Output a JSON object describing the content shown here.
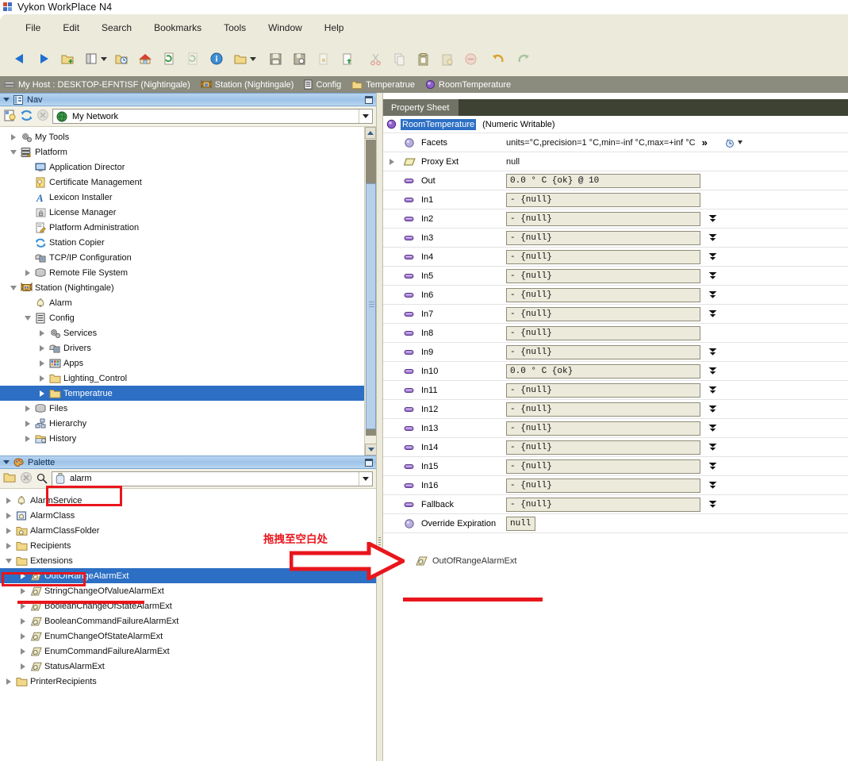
{
  "window": {
    "title": "Vykon WorkPlace N4",
    "icon": "app-logo-icon"
  },
  "menubar": {
    "items": [
      "File",
      "Edit",
      "Search",
      "Bookmarks",
      "Tools",
      "Window",
      "Help"
    ]
  },
  "toolbar": {
    "buttons": [
      {
        "name": "back-icon",
        "label": "Back"
      },
      {
        "name": "forward-icon",
        "label": "Forward"
      },
      {
        "name": "up-folder-icon",
        "label": "Up Level"
      },
      {
        "name": "side-bars-icon",
        "label": "Side Bars",
        "has_caret": true
      },
      {
        "name": "recent-folder-icon",
        "label": "Recent"
      },
      {
        "name": "home-icon",
        "label": "Home"
      },
      {
        "name": "refresh-page-icon",
        "label": "Refresh"
      },
      {
        "name": "refresh-page-disabled-icon",
        "label": "Refresh All"
      },
      {
        "name": "info-icon",
        "label": "Info"
      },
      {
        "name": "open-folder-icon",
        "label": "Open",
        "has_caret": true
      },
      {
        "name": "save-icon",
        "label": "Save"
      },
      {
        "name": "save-as-icon",
        "label": "Save As"
      },
      {
        "name": "lock-page-icon",
        "label": "Lock"
      },
      {
        "name": "new-page-icon",
        "label": "New"
      },
      {
        "name": "cut-icon",
        "label": "Cut"
      },
      {
        "name": "copy-icon",
        "label": "Copy"
      },
      {
        "name": "paste-icon",
        "label": "Paste"
      },
      {
        "name": "paste-special-icon",
        "label": "Paste Special"
      },
      {
        "name": "delete-icon",
        "label": "Delete"
      },
      {
        "name": "undo-icon",
        "label": "Undo"
      },
      {
        "name": "redo-icon",
        "label": "Redo"
      }
    ]
  },
  "locator": {
    "crumbs": [
      {
        "icon": "host-icon",
        "label": "My Host : DESKTOP-EFNTISF (Nightingale)"
      },
      {
        "icon": "station-icon",
        "label": "Station (Nightingale)"
      },
      {
        "icon": "config-icon",
        "label": "Config"
      },
      {
        "icon": "folder-icon",
        "label": "Temperatrue"
      },
      {
        "icon": "point-icon",
        "label": "RoomTemperature"
      }
    ]
  },
  "nav": {
    "panel_title": "Nav",
    "ord_value": "My Network",
    "toolbar_icons": [
      "new-bookmark-icon",
      "sync-icon",
      "stop-icon"
    ],
    "tree": [
      {
        "label": "My Tools",
        "indent": 1,
        "twisty": "closed",
        "icon": "gears-icon"
      },
      {
        "label": "Platform",
        "indent": 1,
        "twisty": "open",
        "icon": "platform-icon"
      },
      {
        "label": "Application Director",
        "indent": 2,
        "twisty": "none",
        "icon": "monitor-icon"
      },
      {
        "label": "Certificate Management",
        "indent": 2,
        "twisty": "none",
        "icon": "certificate-icon"
      },
      {
        "label": "Lexicon Installer",
        "indent": 2,
        "twisty": "none",
        "icon": "lexicon-a-icon"
      },
      {
        "label": "License Manager",
        "indent": 2,
        "twisty": "none",
        "icon": "license-lock-icon"
      },
      {
        "label": "Platform Administration",
        "indent": 2,
        "twisty": "none",
        "icon": "admin-pencil-icon"
      },
      {
        "label": "Station Copier",
        "indent": 2,
        "twisty": "none",
        "icon": "sync-icon"
      },
      {
        "label": "TCP/IP Configuration",
        "indent": 2,
        "twisty": "none",
        "icon": "network-icon"
      },
      {
        "label": "Remote File System",
        "indent": 2,
        "twisty": "closed",
        "icon": "drive-icon"
      },
      {
        "label": "Station (Nightingale)",
        "indent": 1,
        "twisty": "open",
        "icon": "station-icon"
      },
      {
        "label": "Alarm",
        "indent": 2,
        "twisty": "none",
        "icon": "bell-icon"
      },
      {
        "label": "Config",
        "indent": 2,
        "twisty": "open",
        "icon": "config-icon"
      },
      {
        "label": "Services",
        "indent": 3,
        "twisty": "closed",
        "icon": "gears-icon"
      },
      {
        "label": "Drivers",
        "indent": 3,
        "twisty": "closed",
        "icon": "network-icon"
      },
      {
        "label": "Apps",
        "indent": 3,
        "twisty": "closed",
        "icon": "apps-icon"
      },
      {
        "label": "Lighting_Control",
        "indent": 3,
        "twisty": "closed",
        "icon": "folder-icon"
      },
      {
        "label": "Temperatrue",
        "indent": 3,
        "twisty": "closed",
        "icon": "folder-icon",
        "selected": true
      },
      {
        "label": "Files",
        "indent": 2,
        "twisty": "closed",
        "icon": "drive-icon"
      },
      {
        "label": "Hierarchy",
        "indent": 2,
        "twisty": "closed",
        "icon": "hierarchy-icon"
      },
      {
        "label": "History",
        "indent": 2,
        "twisty": "closed",
        "icon": "history-icon"
      }
    ]
  },
  "palette": {
    "panel_title": "Palette",
    "toolbar_icons": [
      "open-palette-icon",
      "close-palette-icon",
      "search-icon"
    ],
    "module_value": "alarm",
    "tree": [
      {
        "label": "AlarmService",
        "indent": 1,
        "twisty": "closed",
        "icon": "bell-icon"
      },
      {
        "label": "AlarmClass",
        "indent": 1,
        "twisty": "closed",
        "icon": "alarm-class-icon"
      },
      {
        "label": "AlarmClassFolder",
        "indent": 1,
        "twisty": "closed",
        "icon": "alarm-folder-icon"
      },
      {
        "label": "Recipients",
        "indent": 1,
        "twisty": "closed",
        "icon": "folder-icon"
      },
      {
        "label": "Extensions",
        "indent": 1,
        "twisty": "open",
        "icon": "folder-icon",
        "boxed": true
      },
      {
        "label": "OutOfRangeAlarmExt",
        "indent": 2,
        "twisty": "closed",
        "icon": "alarm-ext-icon",
        "selected": true,
        "underlined": true
      },
      {
        "label": "StringChangeOfValueAlarmExt",
        "indent": 2,
        "twisty": "closed",
        "icon": "alarm-ext-icon"
      },
      {
        "label": "BooleanChangeOfStateAlarmExt",
        "indent": 2,
        "twisty": "closed",
        "icon": "alarm-ext-icon"
      },
      {
        "label": "BooleanCommandFailureAlarmExt",
        "indent": 2,
        "twisty": "closed",
        "icon": "alarm-ext-icon"
      },
      {
        "label": "EnumChangeOfStateAlarmExt",
        "indent": 2,
        "twisty": "closed",
        "icon": "alarm-ext-icon"
      },
      {
        "label": "EnumCommandFailureAlarmExt",
        "indent": 2,
        "twisty": "closed",
        "icon": "alarm-ext-icon"
      },
      {
        "label": "StatusAlarmExt",
        "indent": 2,
        "twisty": "closed",
        "icon": "alarm-ext-icon"
      },
      {
        "label": "PrinterRecipients",
        "indent": 1,
        "twisty": "closed",
        "icon": "folder-icon"
      }
    ]
  },
  "property_sheet": {
    "tab_label": "Property Sheet",
    "object_name": "RoomTemperature",
    "object_type": "(Numeric Writable)",
    "facets_more": "≫",
    "rows": [
      {
        "name": "Facets",
        "icon": "point-icon",
        "kind": "text",
        "value": "units=°C,precision=1 °C,min=-inf °C,max=+inf °C",
        "extra": "facets-edit-icon"
      },
      {
        "name": "Proxy Ext",
        "icon": "proxy-icon",
        "kind": "text",
        "value": "null",
        "twisty": "closed"
      },
      {
        "name": "Out",
        "icon": "slot-icon",
        "kind": "box",
        "value": "0.0 ° C {ok} @ 10",
        "dropdown": false
      },
      {
        "name": "In1",
        "icon": "slot-icon",
        "kind": "box",
        "value": "- {null}",
        "dropdown": false
      },
      {
        "name": "In2",
        "icon": "slot-icon",
        "kind": "box",
        "value": "- {null}",
        "dropdown": true
      },
      {
        "name": "In3",
        "icon": "slot-icon",
        "kind": "box",
        "value": "- {null}",
        "dropdown": true
      },
      {
        "name": "In4",
        "icon": "slot-icon",
        "kind": "box",
        "value": "- {null}",
        "dropdown": true
      },
      {
        "name": "In5",
        "icon": "slot-icon",
        "kind": "box",
        "value": "- {null}",
        "dropdown": true
      },
      {
        "name": "In6",
        "icon": "slot-icon",
        "kind": "box",
        "value": "- {null}",
        "dropdown": true
      },
      {
        "name": "In7",
        "icon": "slot-icon",
        "kind": "box",
        "value": "- {null}",
        "dropdown": true
      },
      {
        "name": "In8",
        "icon": "slot-icon",
        "kind": "box",
        "value": "- {null}",
        "dropdown": false
      },
      {
        "name": "In9",
        "icon": "slot-icon",
        "kind": "box",
        "value": "- {null}",
        "dropdown": true
      },
      {
        "name": "In10",
        "icon": "slot-icon",
        "kind": "box",
        "value": "0.0 ° C {ok}",
        "dropdown": true
      },
      {
        "name": "In11",
        "icon": "slot-icon",
        "kind": "box",
        "value": "- {null}",
        "dropdown": true
      },
      {
        "name": "In12",
        "icon": "slot-icon",
        "kind": "box",
        "value": "- {null}",
        "dropdown": true
      },
      {
        "name": "In13",
        "icon": "slot-icon",
        "kind": "box",
        "value": "- {null}",
        "dropdown": true
      },
      {
        "name": "In14",
        "icon": "slot-icon",
        "kind": "box",
        "value": "- {null}",
        "dropdown": true
      },
      {
        "name": "In15",
        "icon": "slot-icon",
        "kind": "box",
        "value": "- {null}",
        "dropdown": true
      },
      {
        "name": "In16",
        "icon": "slot-icon",
        "kind": "box",
        "value": "- {null}",
        "dropdown": true
      },
      {
        "name": "Fallback",
        "icon": "slot-icon",
        "kind": "box",
        "value": "- {null}",
        "dropdown": true
      },
      {
        "name": "Override Expiration",
        "icon": "point-icon",
        "kind": "smallbox",
        "value": "null",
        "dropdown": false
      }
    ]
  },
  "canvas": {
    "dropped_item": {
      "label": "OutOfRangeAlarmExt",
      "icon": "alarm-ext-icon"
    }
  },
  "annotations": {
    "drag_hint": "拖拽至空白处",
    "color": "#e8161c"
  }
}
